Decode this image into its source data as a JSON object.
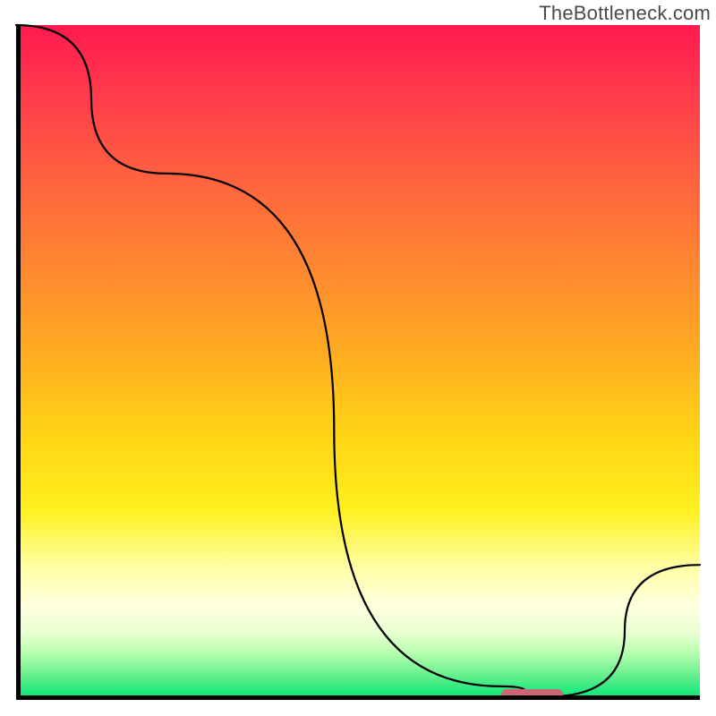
{
  "attribution": "TheBottleneck.com",
  "chart_data": {
    "type": "line",
    "title": "",
    "xlabel": "",
    "ylabel": "",
    "xlim": [
      0,
      100
    ],
    "ylim": [
      0,
      100
    ],
    "x": [
      0,
      22,
      71,
      78,
      100
    ],
    "values": [
      100,
      78,
      2,
      0.5,
      20
    ],
    "optimal_range": {
      "start": 71,
      "end": 80,
      "value": 0.8
    },
    "gradient_stops": [
      {
        "pos": 0,
        "color": "#ff1a4f"
      },
      {
        "pos": 10,
        "color": "#ff3a4c"
      },
      {
        "pos": 22,
        "color": "#ff6040"
      },
      {
        "pos": 36,
        "color": "#ff8830"
      },
      {
        "pos": 50,
        "color": "#ffb020"
      },
      {
        "pos": 62,
        "color": "#ffd815"
      },
      {
        "pos": 72,
        "color": "#fff020"
      },
      {
        "pos": 80,
        "color": "#ffffa0"
      },
      {
        "pos": 86,
        "color": "#ffffe0"
      },
      {
        "pos": 90,
        "color": "#e8ffd0"
      },
      {
        "pos": 93,
        "color": "#b8ffb0"
      },
      {
        "pos": 96,
        "color": "#70f090"
      },
      {
        "pos": 100,
        "color": "#00e676"
      }
    ],
    "marker_color": "#cc6675"
  }
}
